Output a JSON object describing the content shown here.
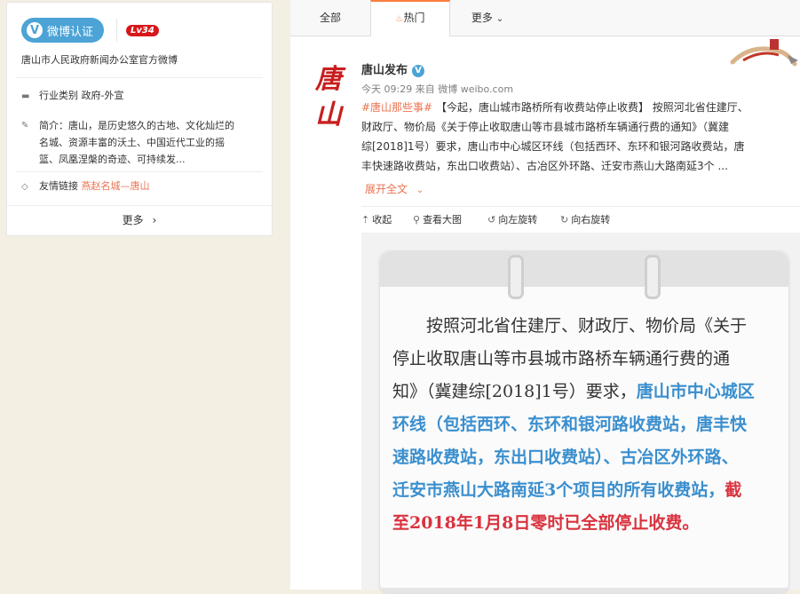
{
  "profile": {
    "verify_label": "微博认证",
    "level": "Lv34",
    "org_description": "唐山市人民政府新闻办公室官方微博",
    "industry_label": "行业类别",
    "industry_value": "政府-外宣",
    "intro_label": "简介：",
    "intro_lines": [
      "唐山，是历史悠久的古地、文化灿烂的",
      "名城、资源丰富的沃土、中国近代工业的摇",
      "篮、凤凰涅槃的奇迹、可持续发..."
    ],
    "links_label": "友情链接",
    "links_value": "燕赵名城—唐山",
    "more_label": "更多"
  },
  "tabs": {
    "all": "全部",
    "hot": "热门",
    "more": "更多"
  },
  "post": {
    "author": "唐山发布",
    "avatar_text": "唐山",
    "time": "今天 09:29",
    "source_prefix": "来自",
    "source": "微博 weibo.com",
    "lines": [
      [
        "#唐山那些事#",
        " 【今起，唐山城市路桥所有收费站停止收费】 按照河北省住建厅、"
      ],
      [
        "",
        "财政厅、物价局《关于停止收取唐山等市县城市路桥车辆通行费的通知》（冀建"
      ],
      [
        "",
        "综[2018]1号）要求，唐山市中心城区环线（包括西环、东环和银河路收费站，唐"
      ],
      [
        "",
        "丰快速路收费站，东出口收费站）、古冶区外环路、迁安市燕山大路南延3个 ..."
      ]
    ],
    "expand_label": "展开全文",
    "actions": {
      "collapse": "收起",
      "view_large": "查看大图",
      "rotate_left": "向左旋转",
      "rotate_right": "向右旋转"
    }
  },
  "notice": {
    "line1": "按照河北省住建厅、财政厅、物价局《关于",
    "line2": "停止收取唐山等市县城市路桥车辆通行费的通",
    "line3_a": "知》（冀建综[2018]1号）要求，",
    "line3_b": "唐山市中心城区",
    "line4": "环线（包括西环、东环和银河路收费站，唐丰快",
    "line5_a": "速路收费站，东出口收费站）",
    "line5_b": "、古冶区外环路、",
    "line6_a": "迁安市燕山大路南延3个项目的所有收费站，",
    "line6_b": "截",
    "line7": "至2018年1月8日零时已全部停止收费。"
  },
  "colors": {
    "accent": "#eb7350",
    "verify_blue": "#4ba3d6",
    "notice_blue": "#3b8fce",
    "notice_red": "#d9333f",
    "level_red": "#d7171a"
  },
  "icons": [
    "verify-icon",
    "briefcase-icon",
    "edit-icon",
    "tag-icon",
    "chevron-right-icon",
    "fire-icon",
    "chevron-down-icon",
    "collapse-icon",
    "search-icon",
    "rotate-left-icon",
    "rotate-right-icon"
  ]
}
